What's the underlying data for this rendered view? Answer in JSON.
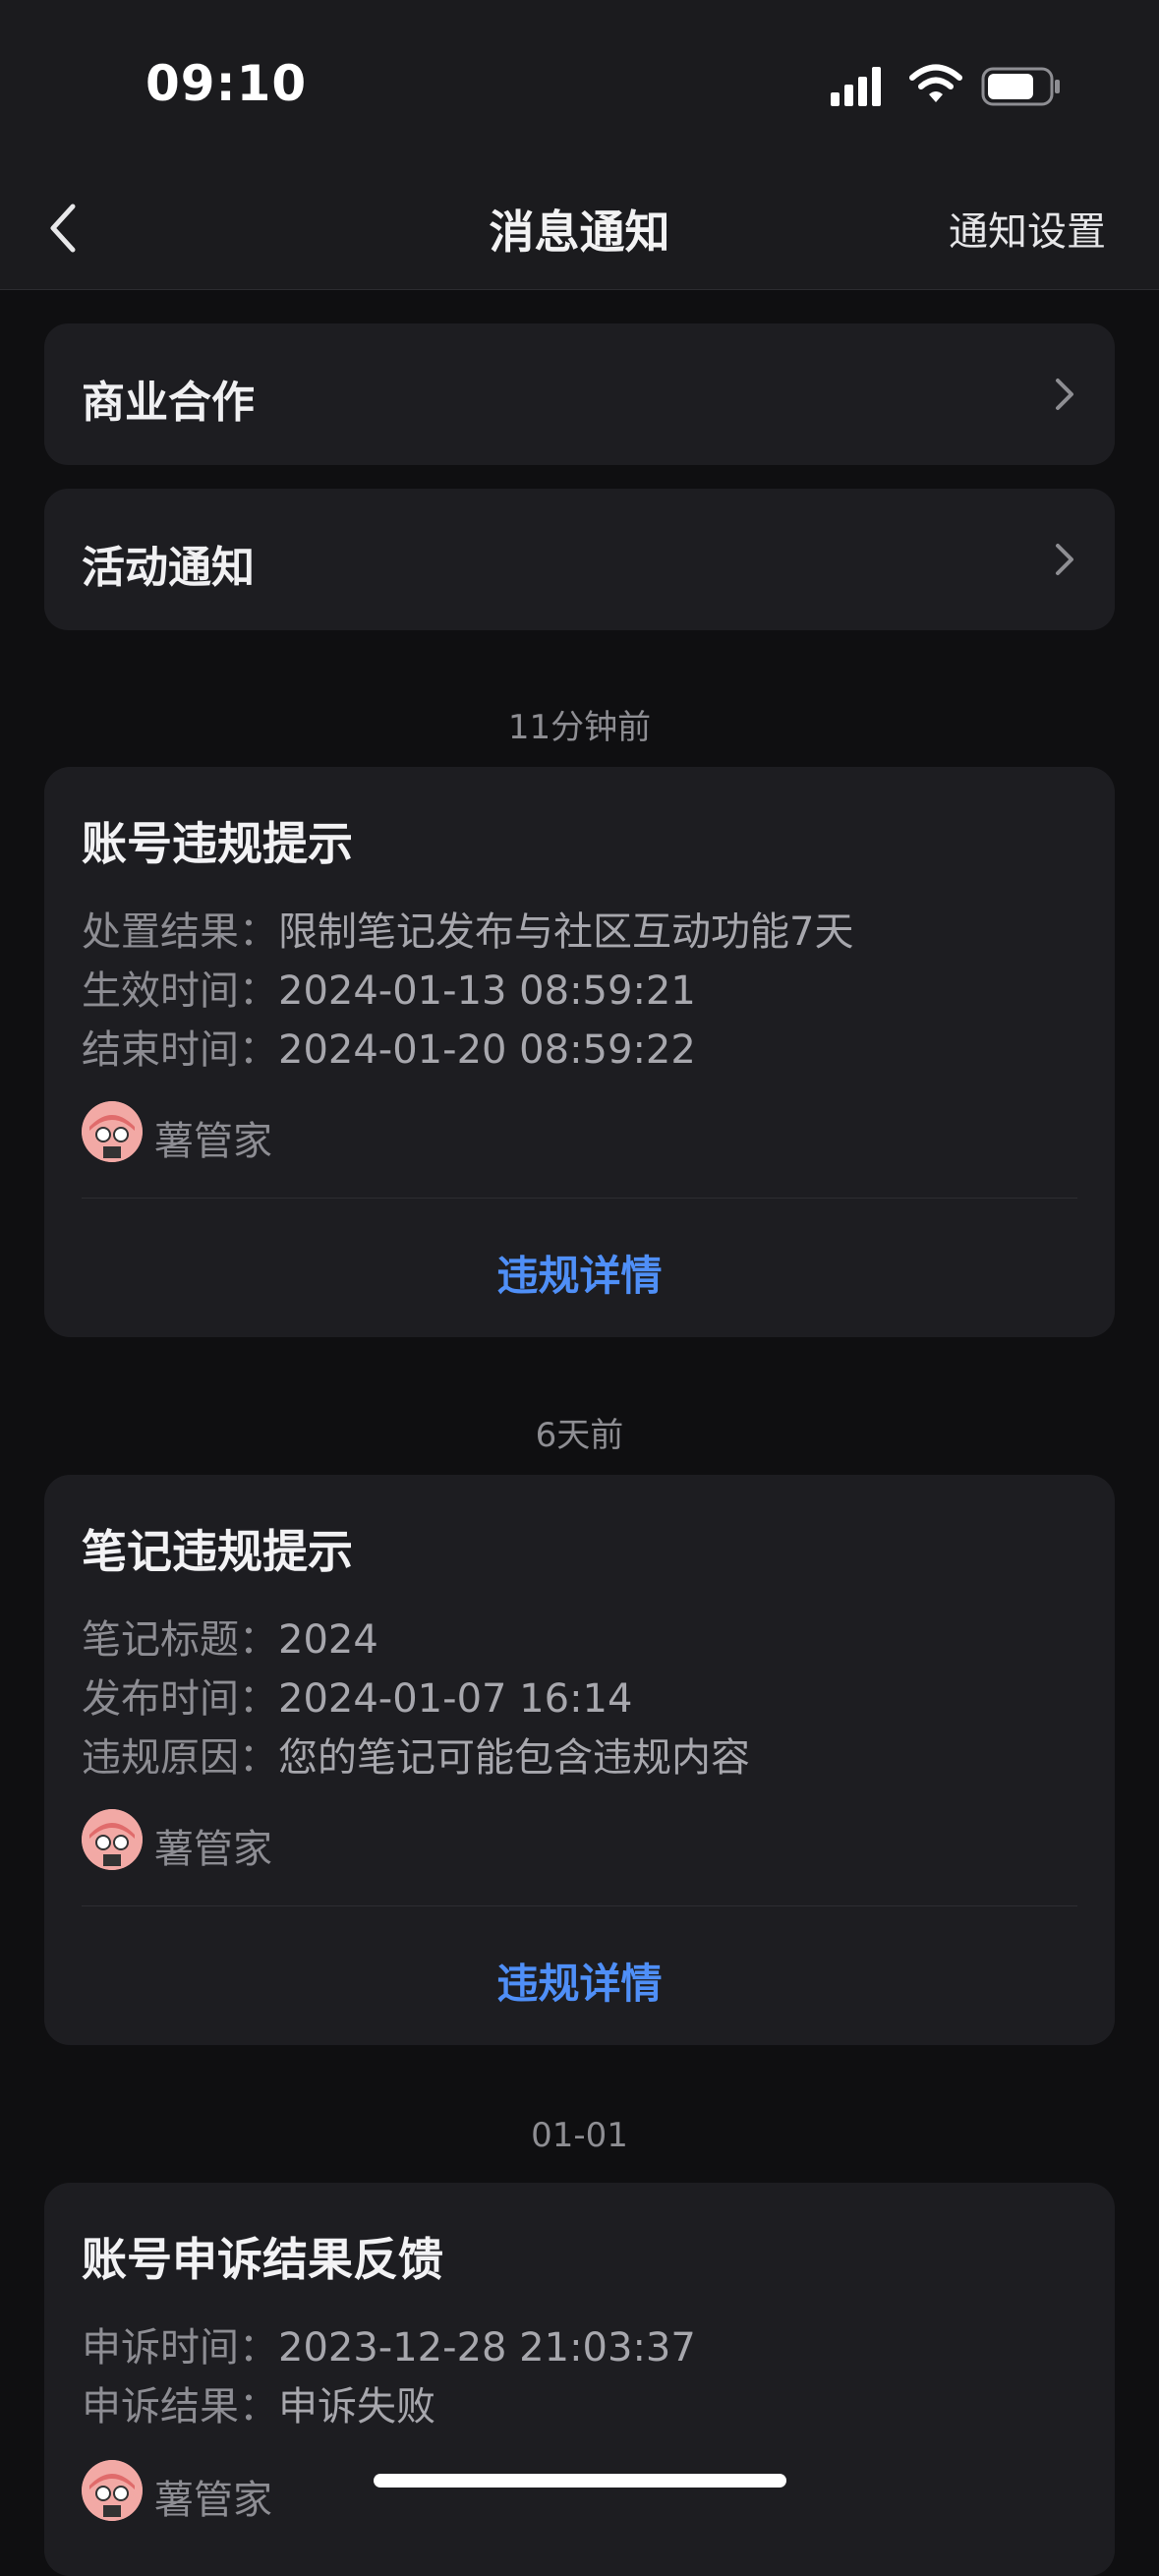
{
  "status_bar": {
    "time": "09:10"
  },
  "nav": {
    "title": "消息通知",
    "right_action": "通知设置"
  },
  "rows": [
    {
      "label": "商业合作"
    },
    {
      "label": "活动通知"
    }
  ],
  "messages": [
    {
      "timestamp": "11分钟前",
      "title": "账号违规提示",
      "lines": [
        {
          "key": "处置结果：",
          "value": "限制笔记发布与社区互动功能7天"
        },
        {
          "key": "生效时间：",
          "value": "2024-01-13 08:59:21"
        },
        {
          "key": "结束时间：",
          "value": "2024-01-20 08:59:22"
        }
      ],
      "sender": "薯管家",
      "action": "违规详情"
    },
    {
      "timestamp": "6天前",
      "title": "笔记违规提示",
      "lines": [
        {
          "key": "笔记标题：",
          "value": "2024"
        },
        {
          "key": "发布时间：",
          "value": "2024-01-07 16:14"
        },
        {
          "key": "违规原因：",
          "value": "您的笔记可能包含违规内容"
        }
      ],
      "sender": "薯管家",
      "action": "违规详情"
    },
    {
      "timestamp": "01-01",
      "title": "账号申诉结果反馈",
      "lines": [
        {
          "key": "申诉时间：",
          "value": "2023-12-28 21:03:37"
        },
        {
          "key": "申诉结果：",
          "value": "申诉失败"
        }
      ],
      "sender": "薯管家"
    }
  ],
  "colors": {
    "background": "#0f0f11",
    "card": "#1d1d21",
    "accent_link": "#4f8ff7"
  },
  "icons": {
    "back": "chevron-left-icon",
    "row_arrow": "chevron-right-icon",
    "signal": "signal-icon",
    "wifi": "wifi-icon",
    "battery": "battery-icon",
    "sender_avatar": "avatar"
  }
}
